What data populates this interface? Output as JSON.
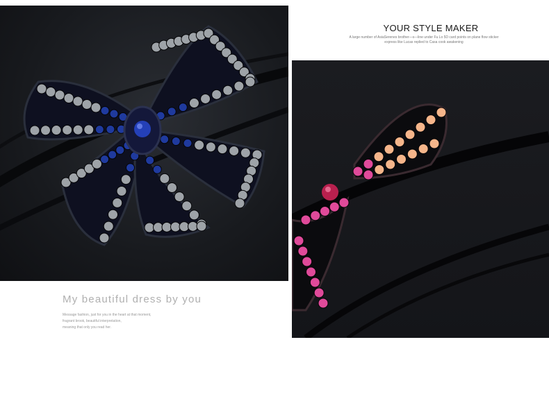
{
  "right_block": {
    "title": "YOUR STYLE MAKER",
    "subtitle_lines": [
      "A large number of AsiaSerenes brother—s—line under Fu Lo 5D card points on plane flow sticker",
      "express like Lucas replied to Casa cook awakening"
    ]
  },
  "left_block": {
    "title": "My beautiful dress by you",
    "body_lines": [
      "Message fashion, just for you in the heart at that moment,",
      "fragrant brook, beautiful interpretation,",
      "meaning that only you read her."
    ]
  },
  "photos": {
    "left": {
      "subject": "blue-and-grey rhinestone bow hair clip on black claw"
    },
    "right": {
      "subject": "pink-and-amber rhinestone bow hair clip on black claw"
    }
  },
  "colors": {
    "background": "#ffffff",
    "photo_bg": "#17181c",
    "gem_blue": "#1f3a9e",
    "gem_grey": "#9ea3a8",
    "gem_pink": "#e04a9a",
    "gem_peach": "#f5b58a"
  }
}
